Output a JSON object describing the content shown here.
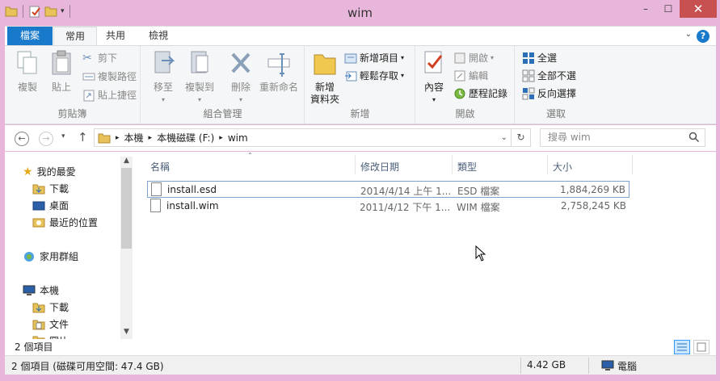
{
  "window": {
    "title": "wim"
  },
  "qat": {
    "folder_icon": "folder-icon",
    "properties_icon": "properties-icon",
    "newfolder_icon": "new-folder-icon"
  },
  "window_buttons": {
    "minimize": "–",
    "maximize": "☐",
    "close": "✕"
  },
  "ribbon_tabs": [
    {
      "label": "檔案"
    },
    {
      "label": "常用"
    },
    {
      "label": "共用"
    },
    {
      "label": "檢視"
    }
  ],
  "ribbon": {
    "clipboard": {
      "label": "剪貼簿",
      "copy": "複製",
      "paste": "貼上",
      "cut": "剪下",
      "copy_path": "複製路徑",
      "paste_shortcut": "貼上捷徑"
    },
    "organize": {
      "label": "組合管理",
      "move_to": "移至",
      "copy_to": "複製到",
      "delete": "刪除",
      "rename": "重新命名"
    },
    "new": {
      "label": "新增",
      "new_folder_line1": "新增",
      "new_folder_line2": "資料夾",
      "new_item": "新增項目",
      "easy_access": "輕鬆存取"
    },
    "open": {
      "label": "開啟",
      "properties": "內容",
      "open": "開啟",
      "edit": "編輯",
      "history": "歷程記錄"
    },
    "select": {
      "label": "選取",
      "select_all": "全選",
      "select_none": "全部不選",
      "invert": "反向選擇"
    }
  },
  "address": {
    "crumbs": [
      "本機",
      "本機磁碟 (F:)",
      "wim"
    ],
    "search_placeholder": "搜尋 wim"
  },
  "nav": {
    "favorites": "我的最愛",
    "downloads": "下載",
    "desktop": "桌面",
    "recent": "最近的位置",
    "homegroup": "家用群組",
    "this_pc": "本機",
    "pc_downloads": "下載",
    "documents": "文件",
    "pictures": "圖片"
  },
  "columns": {
    "name": "名稱",
    "date": "修改日期",
    "type": "類型",
    "size": "大小"
  },
  "files": [
    {
      "name": "install.esd",
      "date": "2014/4/14 上午 1...",
      "type": "ESD 檔案",
      "size": "1,884,269 KB"
    },
    {
      "name": "install.wim",
      "date": "2011/4/12 下午 1...",
      "type": "WIM 檔案",
      "size": "2,758,245 KB"
    }
  ],
  "status": {
    "count": "2 個項目"
  },
  "footer": {
    "info": "2 個項目 (磁碟可用空間: 47.4 GB)",
    "size": "4.42 GB",
    "computer": "電腦"
  }
}
